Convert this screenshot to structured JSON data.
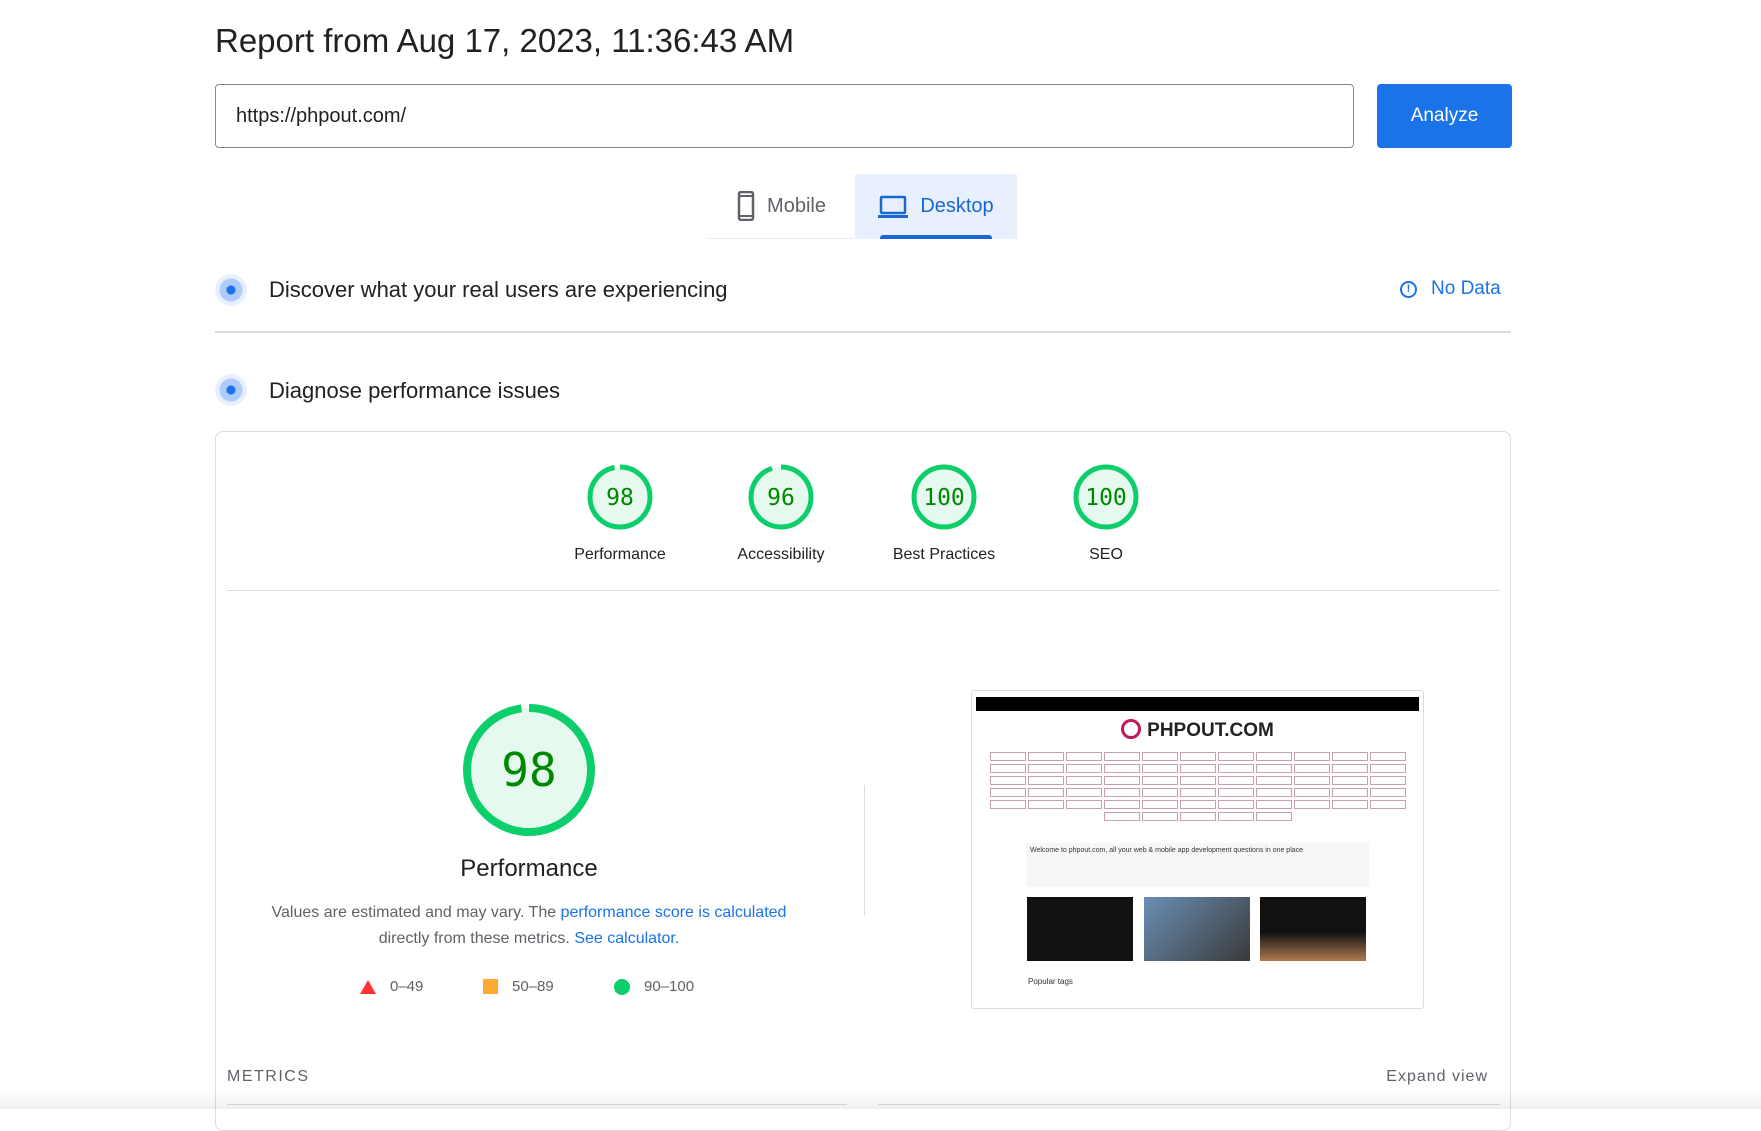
{
  "header": {
    "title": "Report from Aug 17, 2023, 11:36:43 AM"
  },
  "search": {
    "url_value": "https://phpout.com/",
    "analyze_label": "Analyze"
  },
  "device_tabs": [
    {
      "label": "Mobile",
      "icon": "smartphone-icon",
      "selected": false
    },
    {
      "label": "Desktop",
      "icon": "laptop-icon",
      "selected": true
    }
  ],
  "field_data": {
    "title": "Discover what your real users are experiencing",
    "status": "No Data",
    "icon": "info-icon"
  },
  "lab_data": {
    "title": "Diagnose performance issues"
  },
  "scores": [
    {
      "label": "Performance",
      "value": 98
    },
    {
      "label": "Accessibility",
      "value": 96
    },
    {
      "label": "Best Practices",
      "value": 100
    },
    {
      "label": "SEO",
      "value": 100
    }
  ],
  "performance": {
    "score": "98",
    "label": "Performance",
    "text1": "Values are estimated and may vary. The ",
    "link1": "performance score is calculated",
    "text2": "directly from these metrics. ",
    "link2": "See calculator."
  },
  "legend": [
    {
      "range": "0–49",
      "color": "#ff3333",
      "shape": "triangle"
    },
    {
      "range": "50–89",
      "color": "#ffaa33",
      "shape": "square"
    },
    {
      "range": "90–100",
      "color": "#0cce6b",
      "shape": "circle"
    }
  ],
  "screenshot": {
    "site_logo": "PHPOUT.COM",
    "welcome": "Welcome to phpout.com, all your web & mobile app development questions in one place",
    "popular": "Popular tags"
  },
  "metrics": {
    "title": "METRICS",
    "expand": "Expand view"
  },
  "colors": {
    "accent": "#1a73e8",
    "pass": "#0cce6b",
    "pass_text": "#008800"
  }
}
